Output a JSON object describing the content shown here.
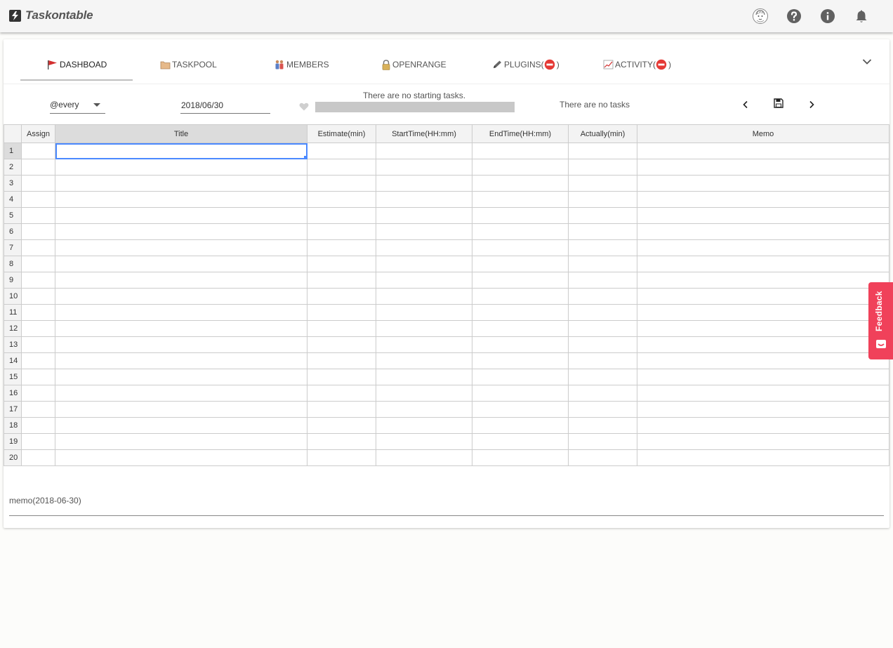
{
  "app": {
    "title": "Taskontable"
  },
  "topbar": {
    "icons": [
      "avatar",
      "help-icon",
      "info-icon",
      "notifications-icon"
    ]
  },
  "tabs": [
    {
      "label": "DASHBOAD",
      "icon": "flag-icon",
      "active": true
    },
    {
      "label": "TASKPOOL",
      "icon": "folder-icon",
      "active": false
    },
    {
      "label": "MEMBERS",
      "icon": "members-icon",
      "active": false
    },
    {
      "label": "OPENRANGE",
      "icon": "lock-icon",
      "active": false
    },
    {
      "label": "PLUGINS(",
      "suffix": ")",
      "icon": "pen-icon",
      "badge": "no-entry-icon",
      "active": false
    },
    {
      "label": "ACTIVITY(",
      "suffix": ")",
      "icon": "chart-icon",
      "badge": "no-entry-icon",
      "active": false
    }
  ],
  "toolbar": {
    "filter_value": "@every",
    "date_value": "2018/06/30",
    "progress_text": "There are no starting tasks.",
    "progress_value": 0,
    "task_status": "There are no tasks"
  },
  "grid": {
    "columns": [
      "Assign",
      "Title",
      "Estimate(min)",
      "StartTime(HH:mm)",
      "EndTime(HH:mm)",
      "Actually(min)",
      "Memo"
    ],
    "row_numbers": [
      "1",
      "2",
      "3",
      "4",
      "5",
      "6",
      "7",
      "8",
      "9",
      "10",
      "11",
      "12",
      "13",
      "14",
      "15",
      "16",
      "17",
      "18",
      "19",
      "20"
    ],
    "selected_row": 1,
    "selected_column": "Title"
  },
  "memo": {
    "label": "memo(2018-06-30)",
    "value": ""
  },
  "feedback": {
    "label": "Feedback"
  },
  "colors": {
    "selection": "#4b89ff",
    "feedback": "#f0415a",
    "appbar": "#f5f5f5"
  }
}
